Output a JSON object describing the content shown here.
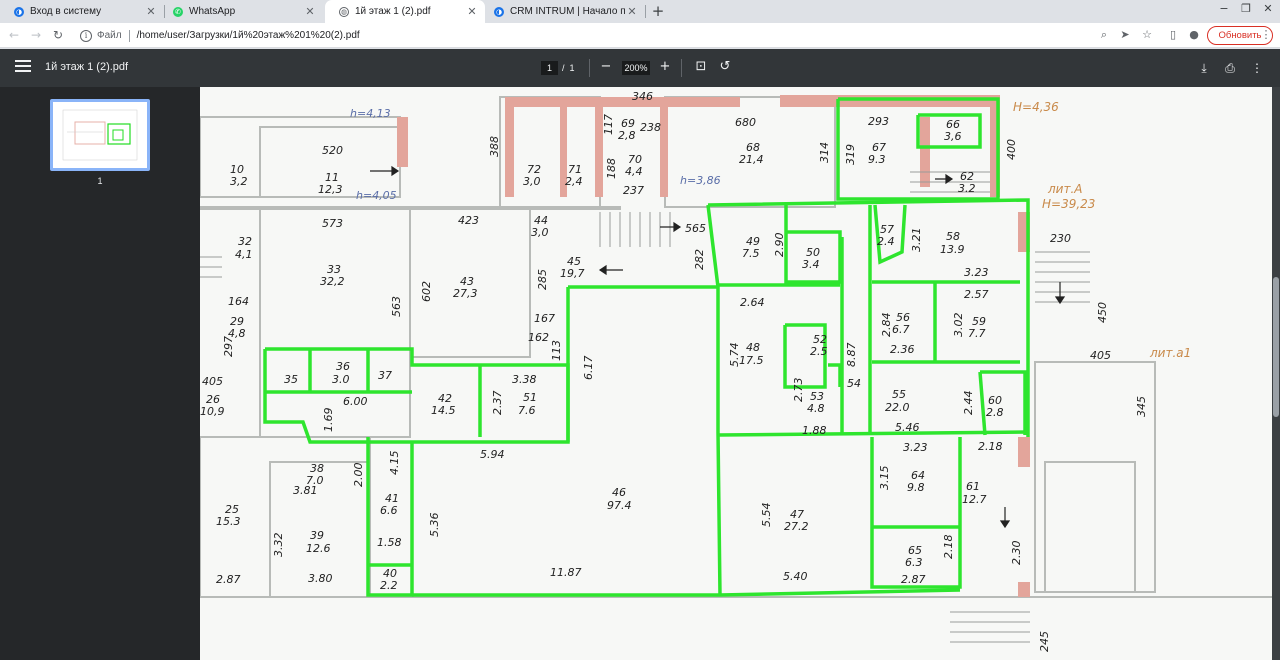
{
  "tabs": [
    {
      "title": "Вход в систему",
      "icon": "intrum-icon",
      "color": "#1a73e8",
      "active": false
    },
    {
      "title": "WhatsApp",
      "icon": "whatsapp-icon",
      "color": "#25d366",
      "active": false
    },
    {
      "title": "1й этаж 1 (2).pdf",
      "icon": "globe-icon",
      "color": "#5f6368",
      "active": true
    },
    {
      "title": "CRM INTRUM | Начало пере",
      "icon": "intrum-icon",
      "color": "#1a73e8",
      "active": false
    }
  ],
  "omnibox": {
    "scheme": "Файл",
    "url": "/home/user/Загрузки/1й%20этаж%201%20(2).pdf"
  },
  "toolbar": {
    "update_label": "Обновить"
  },
  "pdf": {
    "title": "1й этаж 1 (2).pdf",
    "page_current": "1",
    "page_sep": "/",
    "page_total": "1",
    "zoom": "200%",
    "thumb_number": "1"
  },
  "plan": {
    "rooms": [
      {
        "n": "10",
        "a": "3,2"
      },
      {
        "n": "11",
        "a": "12,3"
      },
      {
        "n": "32",
        "a": "4,1"
      },
      {
        "n": "33",
        "a": "32,2"
      },
      {
        "n": "29",
        "a": "4,8"
      },
      {
        "n": "26",
        "a": "10,9"
      },
      {
        "n": "72",
        "a": "3,0"
      },
      {
        "n": "71",
        "a": "2,4"
      },
      {
        "n": "69",
        "a": "2,8"
      },
      {
        "n": "70",
        "a": "4,4"
      },
      {
        "n": "68",
        "a": "21,4"
      },
      {
        "n": "67",
        "a": "9.3"
      },
      {
        "n": "66",
        "a": "3,6"
      },
      {
        "n": "62",
        "a": "3.2"
      },
      {
        "n": "44",
        "a": "3,0"
      },
      {
        "n": "43",
        "a": "27,3"
      },
      {
        "n": "45",
        "a": "19,7"
      },
      {
        "n": "49",
        "a": "7.5"
      },
      {
        "n": "50",
        "a": "3.4"
      },
      {
        "n": "57",
        "a": "2.4"
      },
      {
        "n": "58",
        "a": "13.9"
      },
      {
        "n": "56",
        "a": "6.7"
      },
      {
        "n": "59",
        "a": "7.7"
      },
      {
        "n": "48",
        "a": "17.5"
      },
      {
        "n": "52",
        "a": "2.5"
      },
      {
        "n": "53",
        "a": "4.8"
      },
      {
        "n": "55",
        "a": "22.0"
      },
      {
        "n": "60",
        "a": "2.8"
      },
      {
        "n": "36",
        "a": "3.0"
      },
      {
        "n": "42",
        "a": "14.5"
      },
      {
        "n": "51",
        "a": "7.6"
      },
      {
        "n": "46",
        "a": "97.4"
      },
      {
        "n": "47",
        "a": "27.2"
      },
      {
        "n": "64",
        "a": "9.8"
      },
      {
        "n": "61",
        "a": "12.7"
      },
      {
        "n": "65",
        "a": "6.3"
      },
      {
        "n": "38",
        "a": "7.0"
      },
      {
        "n": "39",
        "a": "12.6"
      },
      {
        "n": "25",
        "a": "15.3"
      },
      {
        "n": "41",
        "a": "6.6"
      },
      {
        "n": "40",
        "a": "2.2"
      }
    ],
    "labels": [
      "h=4,13",
      "h=4,05",
      "h=3,86",
      "H=4,36",
      "лит.А",
      "H=39,23",
      "лит.а1"
    ]
  }
}
